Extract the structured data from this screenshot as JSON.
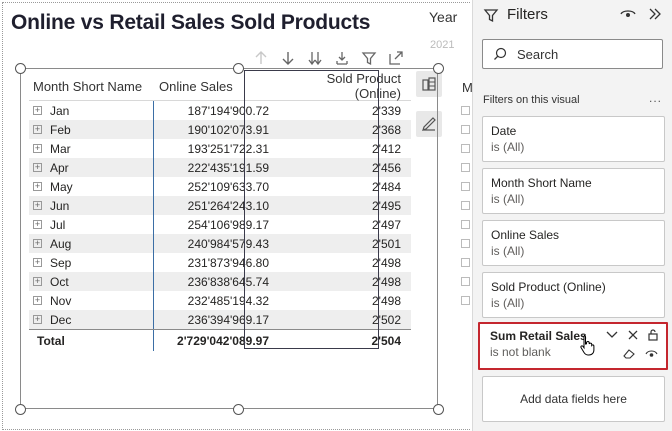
{
  "report": {
    "title": "Online vs Retail Sales Sold Products",
    "slicer_title": "Year",
    "slicer_value": "2021"
  },
  "visual_toolbar": {
    "icons": [
      "drill-up-icon",
      "drill-down-icon",
      "expand-next-level-icon",
      "expand-hierarchy-icon",
      "filter-icon",
      "focus-mode-icon",
      "more-options-icon"
    ]
  },
  "table": {
    "headers": [
      "Month Short Name",
      "Online Sales",
      "Sold Product (Online)"
    ],
    "rows": [
      {
        "month": "Jan",
        "online": "187'194'900.72",
        "sold": "2'339"
      },
      {
        "month": "Feb",
        "online": "190'102'073.91",
        "sold": "2'368"
      },
      {
        "month": "Mar",
        "online": "193'251'722.31",
        "sold": "2'412"
      },
      {
        "month": "Apr",
        "online": "222'435'191.59",
        "sold": "2'456"
      },
      {
        "month": "May",
        "online": "252'109'633.70",
        "sold": "2'484"
      },
      {
        "month": "Jun",
        "online": "251'264'243.10",
        "sold": "2'495"
      },
      {
        "month": "Jul",
        "online": "254'106'989.17",
        "sold": "2'497"
      },
      {
        "month": "Aug",
        "online": "240'984'579.43",
        "sold": "2'501"
      },
      {
        "month": "Sep",
        "online": "231'873'946.80",
        "sold": "2'498"
      },
      {
        "month": "Oct",
        "online": "236'838'645.74",
        "sold": "2'498"
      },
      {
        "month": "Nov",
        "online": "232'485'194.32",
        "sold": "2'498"
      },
      {
        "month": "Dec",
        "online": "236'394'969.17",
        "sold": "2'502"
      }
    ],
    "total": {
      "label": "Total",
      "online": "2'729'042'089.97",
      "sold": "2'504"
    },
    "expand_glyph": "+"
  },
  "right_visual": {
    "header_fragment": "M"
  },
  "filters": {
    "title": "Filters",
    "search_placeholder": "Search",
    "section_label": "Filters on this visual",
    "section_more": "...",
    "cards": [
      {
        "title": "Date",
        "value": "is (All)"
      },
      {
        "title": "Month Short Name",
        "value": "is (All)"
      },
      {
        "title": "Online Sales",
        "value": "is (All)"
      },
      {
        "title": "Sold Product (Online)",
        "value": "is (All)"
      }
    ],
    "active_card": {
      "title": "Sum Retail Sales",
      "value": "is not blank"
    },
    "add_fields_label": "Add data fields here",
    "accent_color": "#c4262e"
  }
}
